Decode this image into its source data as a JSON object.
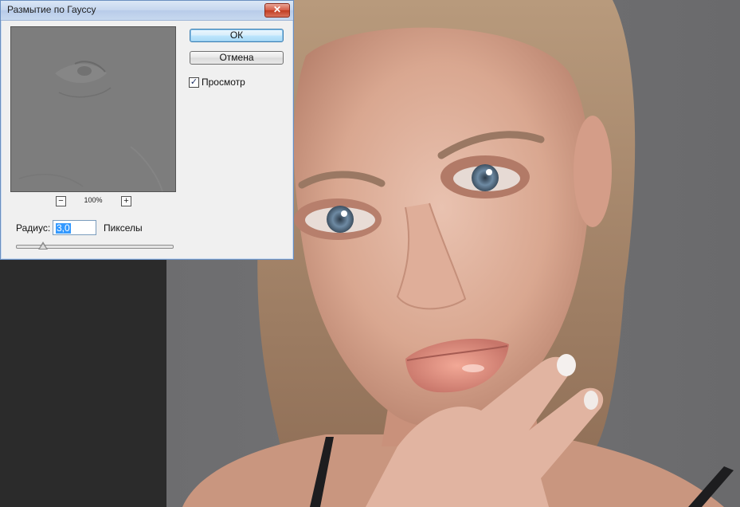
{
  "dialog": {
    "title": "Размытие по Гауссу",
    "close_glyph": "✕",
    "ok_label": "ОК",
    "cancel_label": "Отмена",
    "preview_checkbox": {
      "label": "Просмотр",
      "checked": true,
      "check_glyph": "✓"
    },
    "zoom": {
      "value": "100%",
      "minus_glyph": "−",
      "plus_glyph": "+"
    },
    "radius": {
      "label": "Радиус:",
      "value": "3,0",
      "units": "Пикселы",
      "slider_fraction": 0.17
    }
  },
  "icons": {
    "close": "close-icon",
    "zoom_out": "zoom-out-icon",
    "zoom_in": "zoom-in-icon",
    "check": "check-icon"
  },
  "colors": {
    "dialog_bg": "#f0f0f0",
    "titlebar": "#c5d6ee",
    "close_button": "#c9462e",
    "ok_focus": "#bee6fd",
    "selection": "#3399ff",
    "workspace": "#2b2b2b",
    "backdrop": "#6f6f71"
  }
}
